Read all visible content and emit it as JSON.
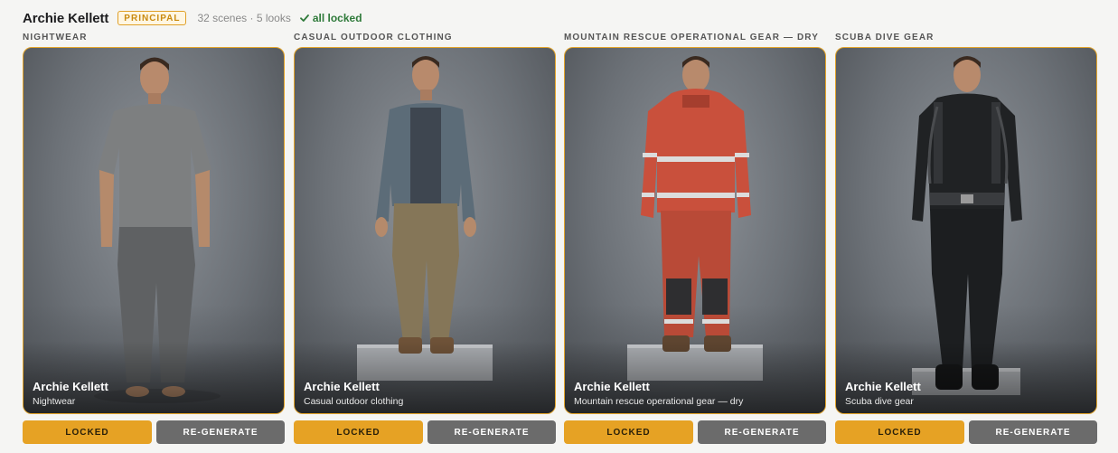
{
  "header": {
    "name": "Archie Kellett",
    "badge": "PRINCIPAL",
    "meta": "32 scenes · 5 looks",
    "status": "all locked",
    "status_icon": "check-icon"
  },
  "colors": {
    "accent": "#e6a224",
    "regen": "#6b6b6b",
    "locked_green": "#2f7a3a"
  },
  "looks": [
    {
      "label": "NIGHTWEAR",
      "caption_name": "Archie Kellett",
      "caption_sub": "Nightwear",
      "lock_label": "LOCKED",
      "regen_label": "RE-GENERATE"
    },
    {
      "label": "CASUAL OUTDOOR CLOTHING",
      "caption_name": "Archie Kellett",
      "caption_sub": "Casual outdoor clothing",
      "lock_label": "LOCKED",
      "regen_label": "RE-GENERATE"
    },
    {
      "label": "MOUNTAIN RESCUE OPERATIONAL GEAR — DRY",
      "caption_name": "Archie Kellett",
      "caption_sub": "Mountain rescue operational gear — dry",
      "lock_label": "LOCKED",
      "regen_label": "RE-GENERATE"
    },
    {
      "label": "SCUBA DIVE GEAR",
      "caption_name": "Archie Kellett",
      "caption_sub": "Scuba dive gear",
      "lock_label": "LOCKED",
      "regen_label": "RE-GENERATE"
    }
  ]
}
